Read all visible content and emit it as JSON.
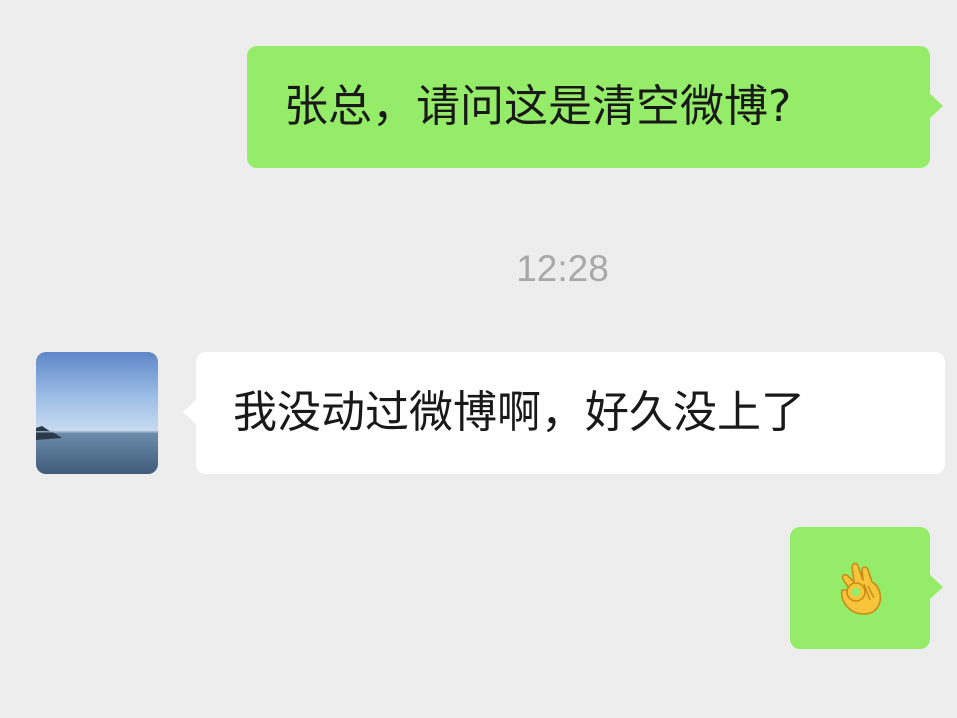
{
  "conversation": {
    "messages": [
      {
        "direction": "outgoing",
        "text": "张总，请问这是清空微博?"
      },
      {
        "direction": "incoming",
        "text": "我没动过微博啊，好久没上了"
      },
      {
        "direction": "outgoing",
        "emoji": "ok-hand",
        "text": "👌"
      }
    ],
    "timestamp": "12:28"
  },
  "contact": {
    "avatar_description": "sea-horizon-photo"
  },
  "colors": {
    "background": "#ededed",
    "outgoing_bubble": "#95ec69",
    "incoming_bubble": "#ffffff",
    "timestamp_text": "#a8a8a8",
    "message_text": "#191919"
  }
}
